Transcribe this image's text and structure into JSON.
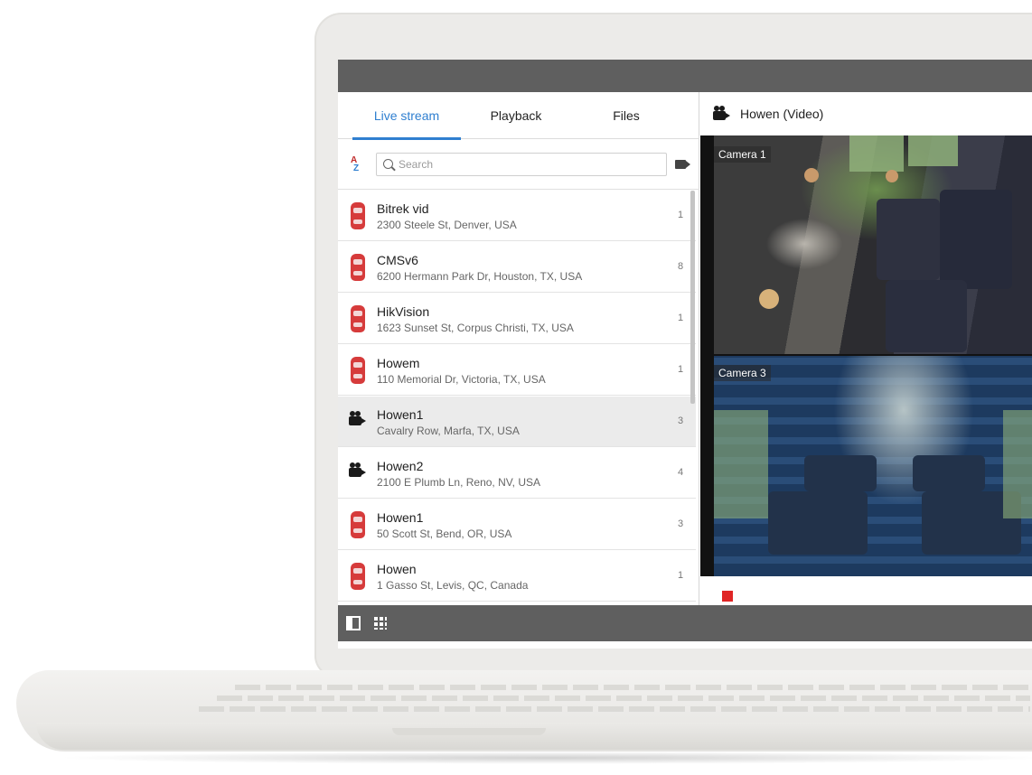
{
  "tabs": {
    "live": "Live stream",
    "playback": "Playback",
    "files": "Files"
  },
  "search": {
    "placeholder": "Search",
    "sort_label_a": "A",
    "sort_label_z": "Z"
  },
  "units": [
    {
      "name": "Bitrek vid",
      "address": "2300 Steele St, Denver, USA",
      "count": "1",
      "icon": "car-icon"
    },
    {
      "name": "CMSv6",
      "address": "6200 Hermann Park Dr, Houston, TX, USA",
      "count": "8",
      "icon": "car-icon"
    },
    {
      "name": "HikVision",
      "address": "1623 Sunset St, Corpus Christi, TX, USA",
      "count": "1",
      "icon": "car-icon"
    },
    {
      "name": "Howem",
      "address": "110 Memorial Dr, Victoria, TX, USA",
      "count": "1",
      "icon": "car-icon"
    },
    {
      "name": "Howen1",
      "address": "Cavalry Row, Marfa, TX, USA",
      "count": "3",
      "icon": "video-camera-icon"
    },
    {
      "name": "Howen2",
      "address": "2100 E Plumb Ln, Reno, NV, USA",
      "count": "4",
      "icon": "video-camera-icon"
    },
    {
      "name": "Howen1",
      "address": "50 Scott St, Bend, OR, USA",
      "count": "3",
      "icon": "car-icon"
    },
    {
      "name": "Howen",
      "address": "1 Gasso St, Levis, QC, Canada",
      "count": "1",
      "icon": "car-icon"
    }
  ],
  "video": {
    "title": "Howen (Video)",
    "cameras": [
      "Camera 1",
      "Camera 3"
    ]
  },
  "colors": {
    "accent": "#2f7fd0",
    "toolbar": "#5f5f5f",
    "record": "#e02525",
    "unit_icon": "#d63b3b"
  }
}
